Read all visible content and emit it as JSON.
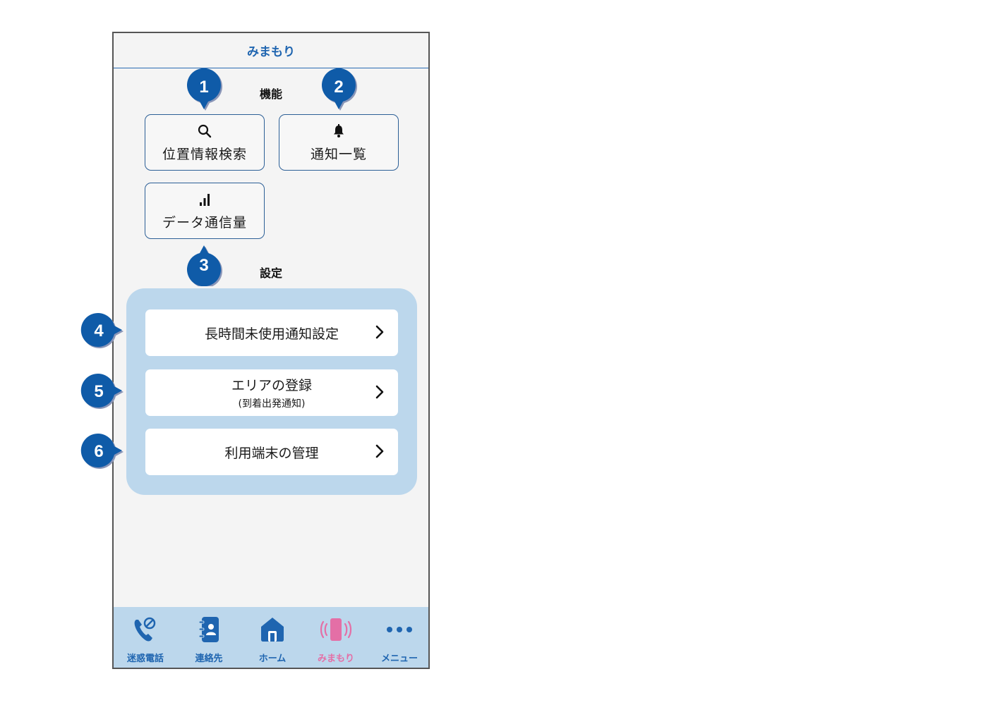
{
  "header": {
    "title": "みまもり"
  },
  "features": {
    "title": "機能",
    "tiles": [
      {
        "label": "位置情報検索",
        "icon": "search-icon"
      },
      {
        "label": "通知一覧",
        "icon": "bell-icon"
      },
      {
        "label": "データ通信量",
        "icon": "signal-bars-icon"
      }
    ]
  },
  "settings": {
    "title": "設定",
    "rows": [
      {
        "label": "長時間未使用通知設定",
        "sub": ""
      },
      {
        "label": "エリアの登録",
        "sub": "(到着出発通知)"
      },
      {
        "label": "利用端末の管理",
        "sub": ""
      }
    ]
  },
  "bottom_nav": {
    "items": [
      {
        "label": "迷惑電話",
        "icon": "blocked-call-icon",
        "active": false
      },
      {
        "label": "連絡先",
        "icon": "contacts-book-icon",
        "active": false
      },
      {
        "label": "ホーム",
        "icon": "home-icon",
        "active": false
      },
      {
        "label": "みまもり",
        "icon": "vibrating-phone-icon",
        "active": true
      },
      {
        "label": "メニュー",
        "icon": "more-dots-icon",
        "active": false
      }
    ]
  },
  "callouts": [
    "1",
    "2",
    "3",
    "4",
    "5",
    "6"
  ],
  "colors": {
    "primary_blue": "#1f65b0",
    "callout_blue": "#0f5ba8",
    "panel_blue": "#bcd7ec",
    "active_pink": "#e46fa6",
    "background": "#f4f4f4"
  }
}
